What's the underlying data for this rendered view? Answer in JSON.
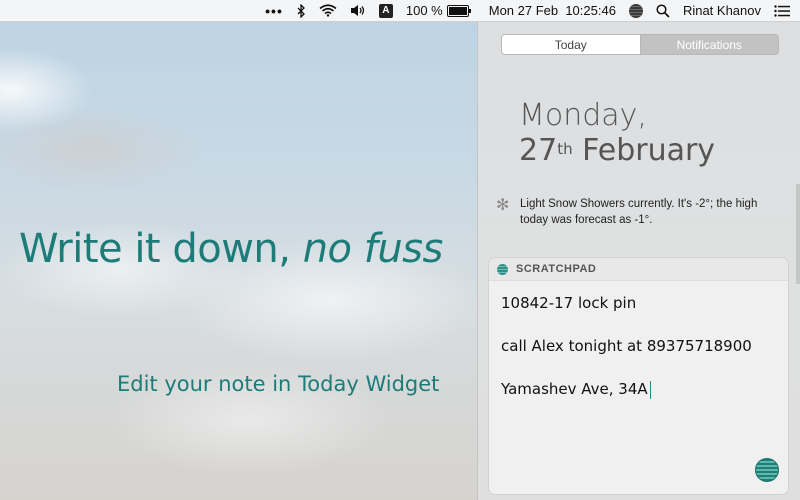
{
  "menubar": {
    "input_source": "A",
    "battery_percent_label": "100 %",
    "battery_level": 1.0,
    "datetime": "Mon 27 Feb  10:25:46",
    "user": "Rinat Khanov"
  },
  "promo": {
    "headline_plain": "Write it down, ",
    "headline_italic": "no fuss",
    "subline": "Edit your note in Today Widget"
  },
  "notification_center": {
    "tabs": [
      {
        "label": "Today",
        "active": true
      },
      {
        "label": "Notifications",
        "active": false
      }
    ],
    "day": "Monday,",
    "date_num": "27",
    "date_suffix": "th",
    "month": "February",
    "weather_text": "Light Snow Showers currently. It's -2°; the high today was forecast as -1°."
  },
  "widget": {
    "title": "SCRATCHPAD",
    "lines": [
      "10842-17 lock pin",
      "call Alex tonight at 89375718900",
      "Yamashev Ave, 34A"
    ]
  },
  "colors": {
    "accent": "#1d7b78"
  }
}
